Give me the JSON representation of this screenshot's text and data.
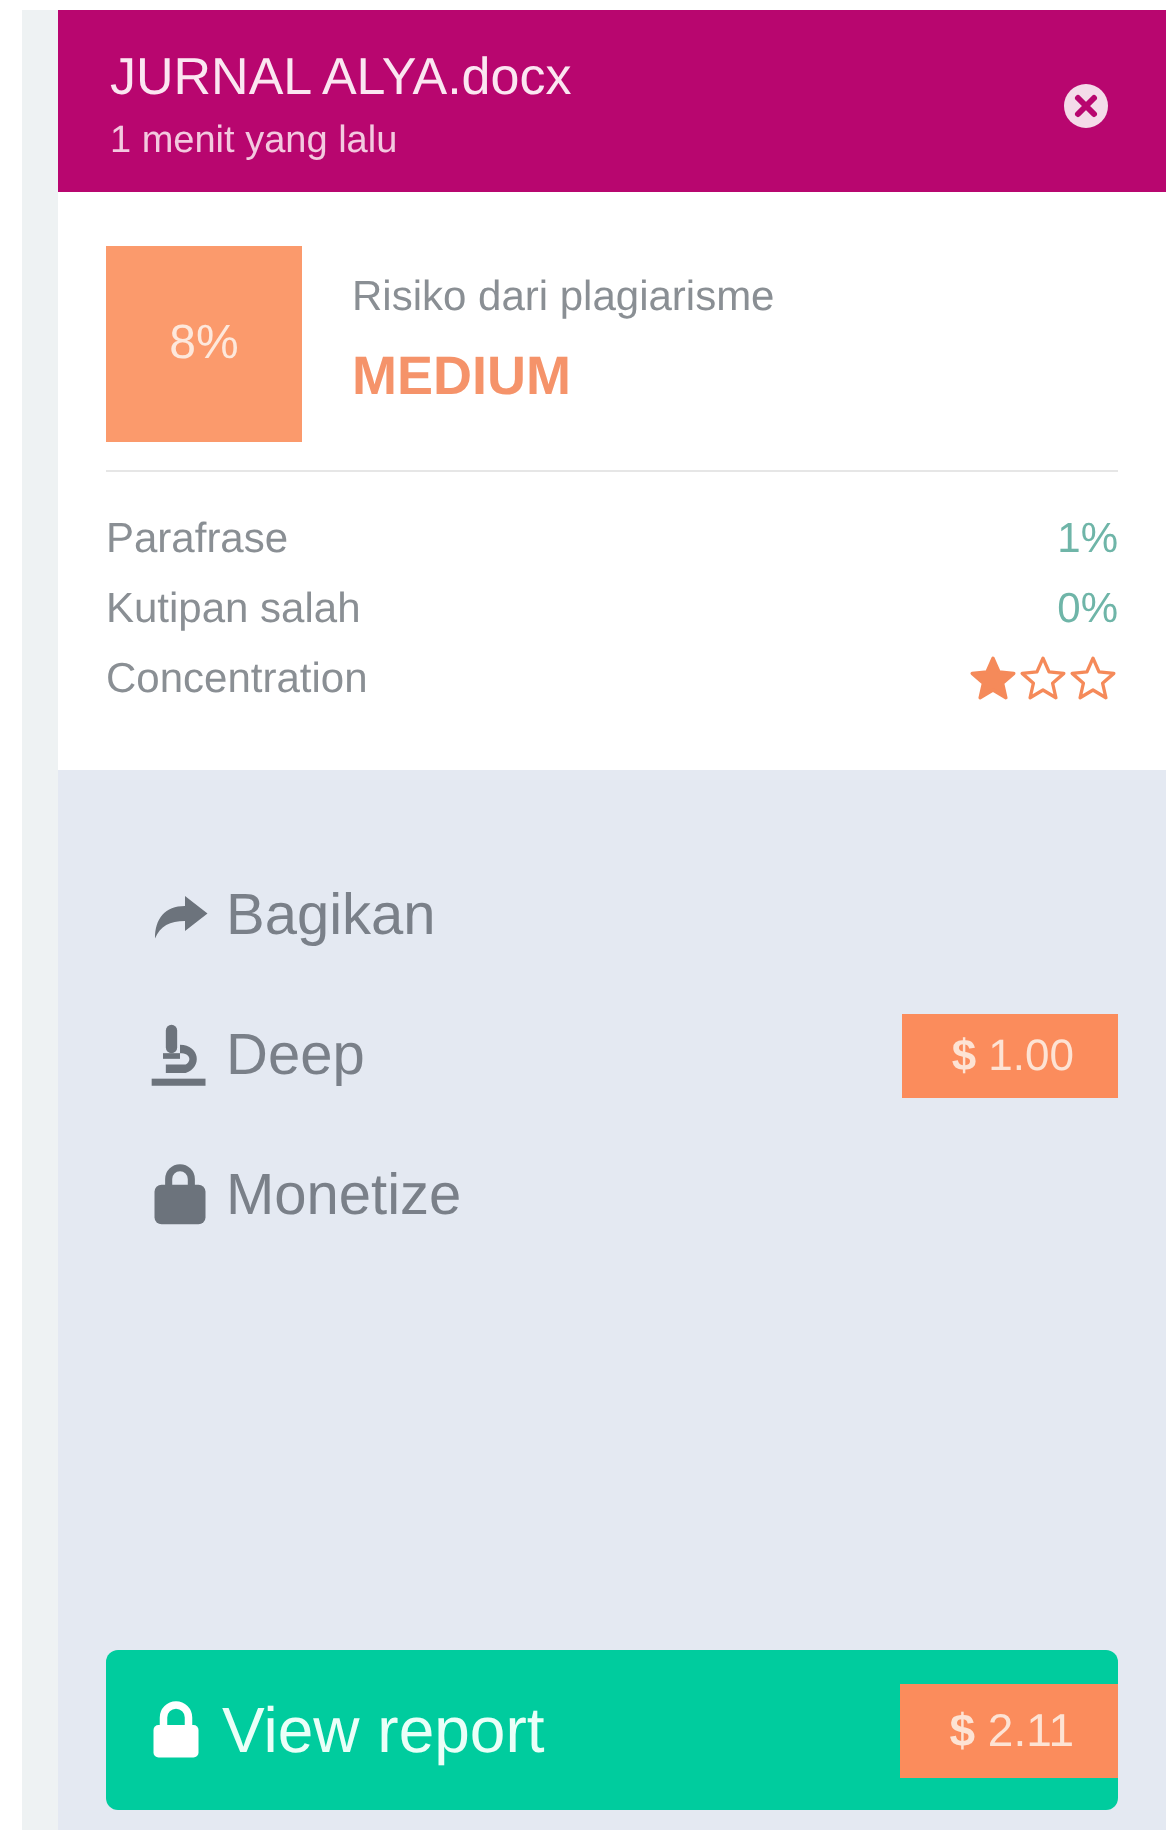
{
  "header": {
    "title": "JURNAL ALYA.docx",
    "subtitle": "1 menit yang lalu"
  },
  "risk": {
    "percent": "8%",
    "label": "Risiko dari plagiarisme",
    "level_text": "MEDIUM"
  },
  "metrics": [
    {
      "name": "Parafrase",
      "value": "1%"
    },
    {
      "name": "Kutipan salah",
      "value": "0%"
    }
  ],
  "concentration": {
    "name": "Concentration",
    "stars": 1
  },
  "actions": [
    {
      "label": "Bagikan"
    },
    {
      "label": "Deep",
      "price": "**$** 1.00"
    },
    {
      "label": "Monetize"
    }
  ],
  "view_report": {
    "label": "View report",
    "price": "**$** 2.11"
  }
}
